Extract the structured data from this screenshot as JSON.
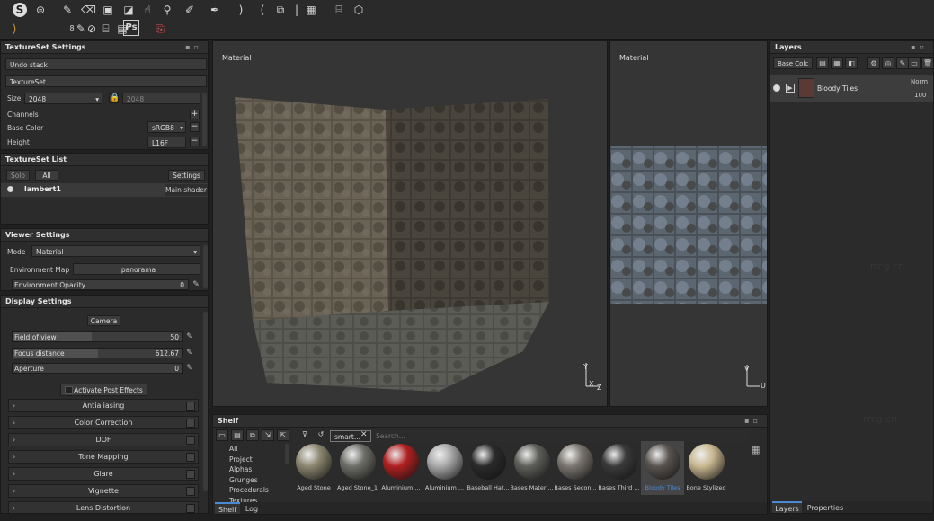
{
  "toolbar": {
    "icons_row1": [
      "logo-icon",
      "symmetry-icon",
      "paint-brush-icon",
      "eraser-icon",
      "projection-icon",
      "polygon-fill-icon",
      "smudge-icon",
      "clone-stamp-icon",
      "color-picker-icon",
      "geometry-mask-icon",
      "mirror-left-icon",
      "mirror-right-icon",
      "texture-mode-icon",
      "camera-icon",
      "material-view-icon",
      "cube-icon"
    ],
    "row2_value": "8",
    "ps_label": "Ps"
  },
  "textureset_settings": {
    "title": "TextureSet Settings",
    "undo_stack": "Undo stack",
    "textureset_label": "TextureSet",
    "size_label": "Size",
    "size_value": "2048",
    "size_value2": "2048",
    "channels_label": "Channels",
    "base_color_label": "Base Color",
    "base_color_format": "sRGB8",
    "height_label": "Height",
    "height_format": "L16F"
  },
  "textureset_list": {
    "title": "TextureSet List",
    "solo_label": "Solo",
    "all_label": "All",
    "settings_label": "Settings",
    "item_name": "lambert1",
    "item_shader": "Main shader"
  },
  "viewer_settings": {
    "title": "Viewer Settings",
    "mode_label": "Mode",
    "mode_value": "Material",
    "env_map_label": "Environment Map",
    "env_map_value": "panorama",
    "env_opacity_label": "Environment Opacity",
    "env_opacity_value": "0"
  },
  "display_settings": {
    "title": "Display Settings",
    "camera_label": "Camera",
    "fov_label": "Field of view",
    "fov_value": "50",
    "focus_label": "Focus distance",
    "focus_value": "612.67",
    "aperture_label": "Aperture",
    "aperture_value": "0",
    "post_effects_label": "Activate Post Effects",
    "effects": [
      "Antialiasing",
      "Color Correction",
      "DOF",
      "Tone Mapping",
      "Glare",
      "Vignette",
      "Lens Distortion"
    ]
  },
  "viewport_3d": {
    "label": "Material"
  },
  "viewport_2d": {
    "label": "Material"
  },
  "shelf": {
    "title": "Shelf",
    "filter_tag": "smart...",
    "search_placeholder": "Search...",
    "tree": [
      "All",
      "Project",
      "Alphas",
      "Grunges",
      "Procedurals",
      "Textures"
    ],
    "materials": [
      {
        "name": "Aged Stone",
        "color": "#8c8670"
      },
      {
        "name": "Aged Stone_1",
        "color": "#6e6e68"
      },
      {
        "name": "Aluminium ...",
        "color": "#b02020"
      },
      {
        "name": "Aluminium ...",
        "color": "#a8a8a8"
      },
      {
        "name": "Baseball Hat...",
        "color": "#2a2a2a"
      },
      {
        "name": "Bases Materi...",
        "color": "#5e5e5a"
      },
      {
        "name": "Bases Secon...",
        "color": "#7a7570"
      },
      {
        "name": "Bases Third ...",
        "color": "#3a3a3a"
      },
      {
        "name": "Bloody Tiles",
        "color": "#5a5450"
      },
      {
        "name": "Bone Stylized",
        "color": "#c9b890"
      }
    ],
    "selected_index": 8,
    "tabs": [
      "Shelf",
      "Log"
    ]
  },
  "layers": {
    "title": "Layers",
    "channel_value": "Base Colc",
    "layer_name": "Bloody Tiles",
    "blend_mode": "Norm",
    "opacity": "100",
    "tabs": [
      "Layers",
      "Properties"
    ]
  },
  "watermark": "rrcg.cn",
  "colors": {
    "accent": "#4a8ad4",
    "selected": "#3c3c3c"
  }
}
